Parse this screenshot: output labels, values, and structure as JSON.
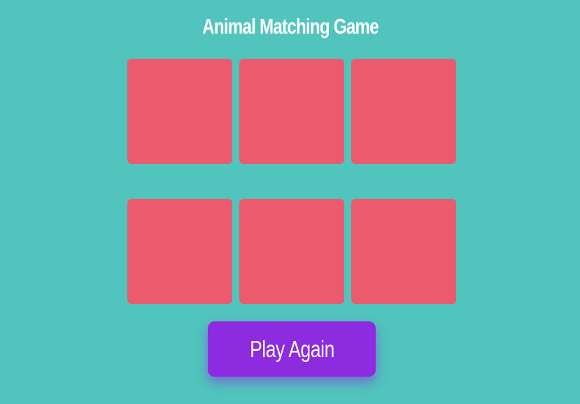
{
  "title": "Animal Matching Game",
  "cards": [
    {
      "state": "face-down"
    },
    {
      "state": "face-down"
    },
    {
      "state": "face-down"
    },
    {
      "state": "face-down"
    },
    {
      "state": "face-down"
    },
    {
      "state": "face-down"
    }
  ],
  "play_again_label": "Play Again",
  "colors": {
    "background": "#51c4bd",
    "card_back": "#ec5a6d",
    "button": "#8c2be0",
    "text": "#ffffff"
  }
}
